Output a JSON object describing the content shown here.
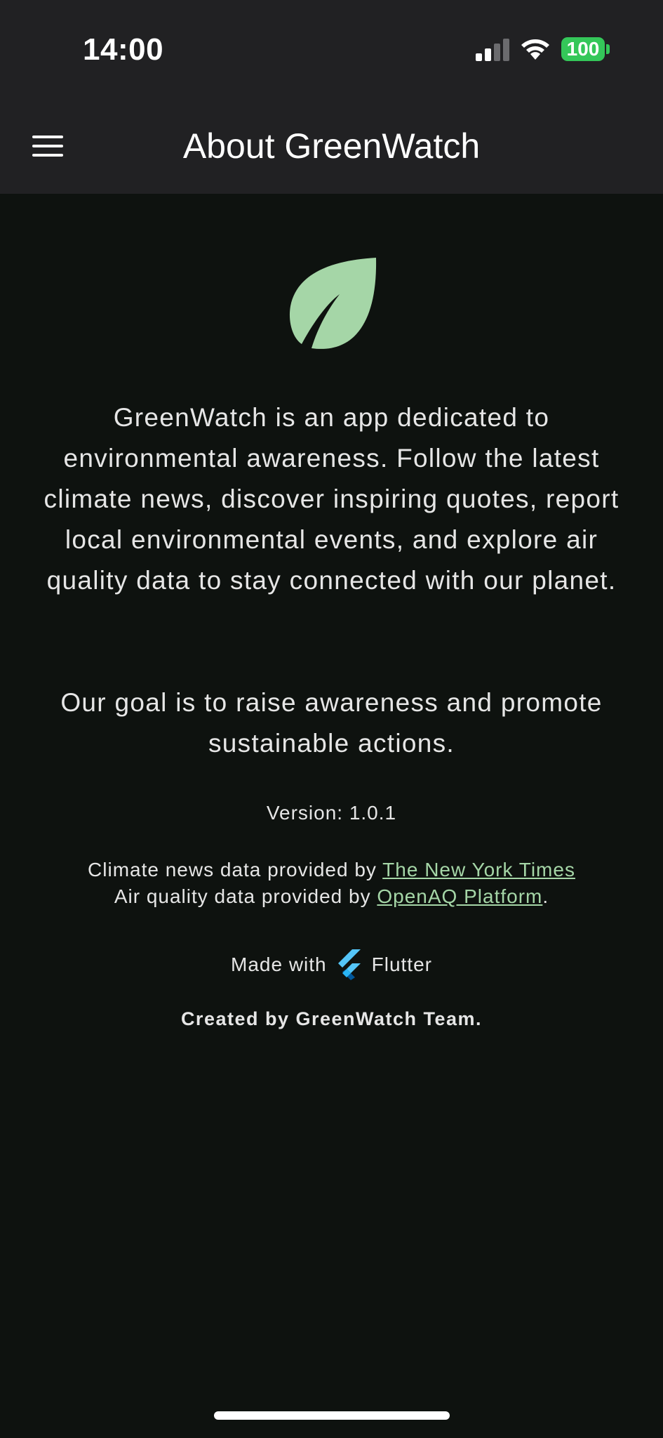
{
  "status_bar": {
    "time": "14:00",
    "battery": "100"
  },
  "app_bar": {
    "title": "About GreenWatch",
    "menu_icon": "hamburger-menu-icon"
  },
  "content": {
    "logo_icon": "leaf-icon",
    "description": "GreenWatch is an app dedicated to environmental awareness. Follow the latest climate news, discover inspiring quotes, report local environmental events, and explore air quality data to stay connected with our planet.",
    "goal": "Our goal is to raise awareness and promote sustainable actions.",
    "version": "Version: 1.0.1",
    "news_credit_prefix": "Climate news data provided by ",
    "news_credit_link": "The New York Times",
    "air_credit_prefix": "Air quality data provided by ",
    "air_credit_link": "OpenAQ Platform",
    "air_credit_suffix": ".",
    "made_with_prefix": "Made with",
    "made_with_name": "Flutter",
    "created_by": "Created by GreenWatch Team."
  },
  "colors": {
    "accent_leaf": "#a5d6a7",
    "background": "#0e120f",
    "app_bar": "#212123",
    "battery": "#34c759"
  }
}
